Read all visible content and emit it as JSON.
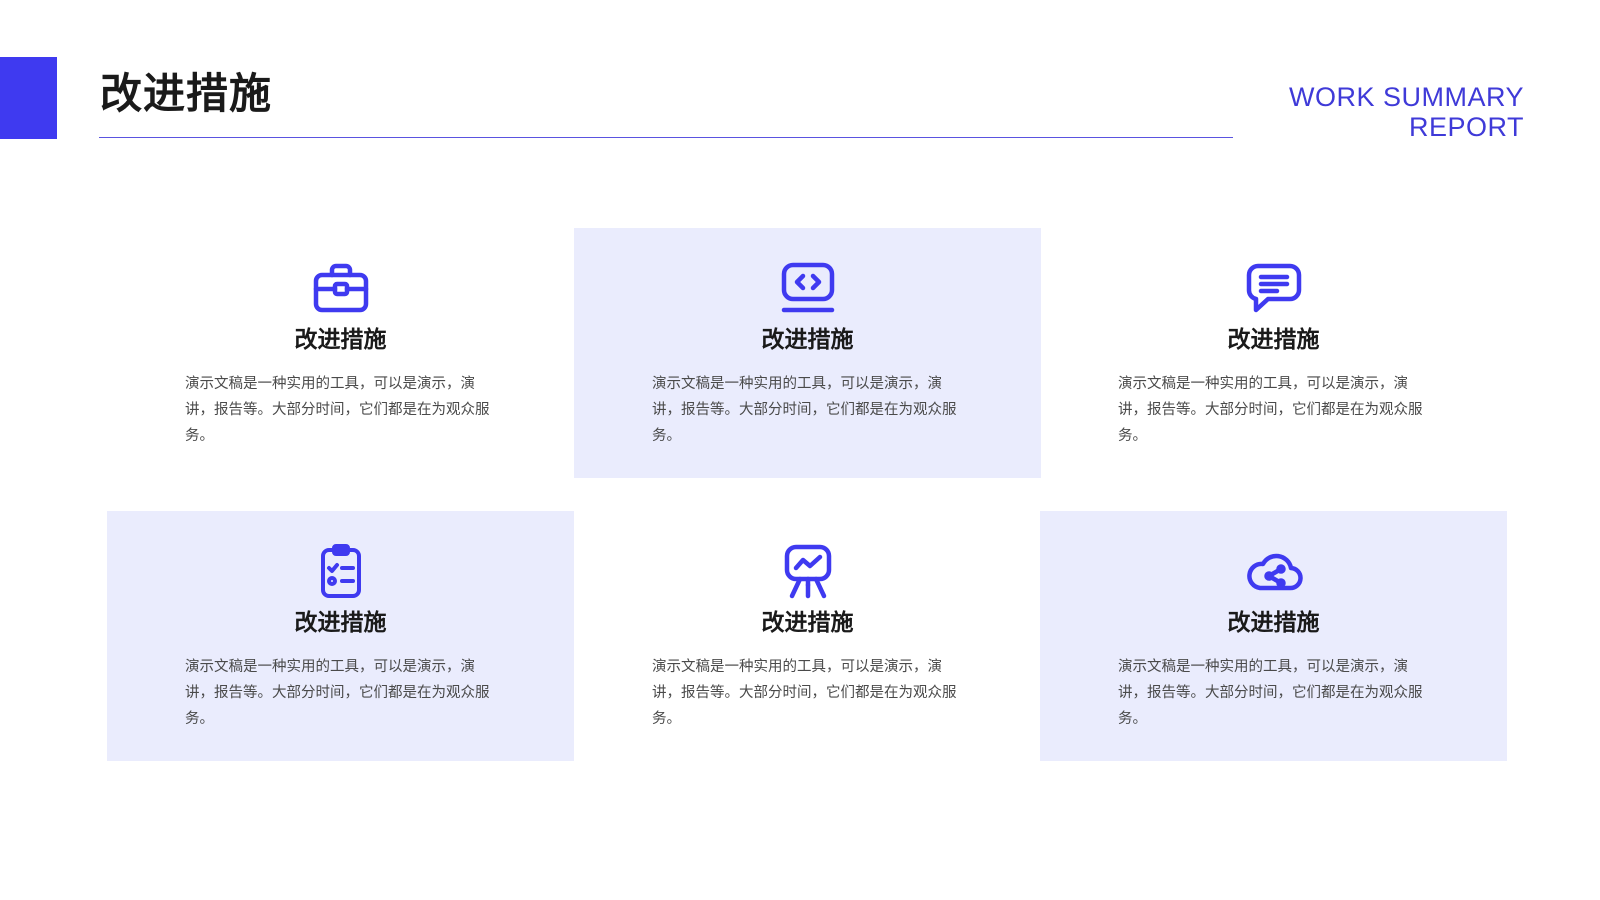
{
  "header": {
    "title": "改进措施",
    "brand_line1": "WORK SUMMARY",
    "brand_line2": "REPORT"
  },
  "colors": {
    "accent": "#3f3af0",
    "card_shade": "#eaecfd",
    "text_dark": "#1a1a1a",
    "text_body": "#4a4a4a"
  },
  "cards": [
    {
      "icon": "briefcase-icon",
      "title": "改进措施",
      "text": "演示文稿是一种实用的工具，可以是演示，演讲，报告等。大部分时间，它们都是在为观众服务。"
    },
    {
      "icon": "code-screen-icon",
      "title": "改进措施",
      "text": "演示文稿是一种实用的工具，可以是演示，演讲，报告等。大部分时间，它们都是在为观众服务。"
    },
    {
      "icon": "chat-bubble-icon",
      "title": "改进措施",
      "text": "演示文稿是一种实用的工具，可以是演示，演讲，报告等。大部分时间，它们都是在为观众服务。"
    },
    {
      "icon": "clipboard-checklist-icon",
      "title": "改进措施",
      "text": "演示文稿是一种实用的工具，可以是演示，演讲，报告等。大部分时间，它们都是在为观众服务。"
    },
    {
      "icon": "presentation-board-icon",
      "title": "改进措施",
      "text": "演示文稿是一种实用的工具，可以是演示，演讲，报告等。大部分时间，它们都是在为观众服务。"
    },
    {
      "icon": "cloud-share-icon",
      "title": "改进措施",
      "text": "演示文稿是一种实用的工具，可以是演示，演讲，报告等。大部分时间，它们都是在为观众服务。"
    }
  ]
}
